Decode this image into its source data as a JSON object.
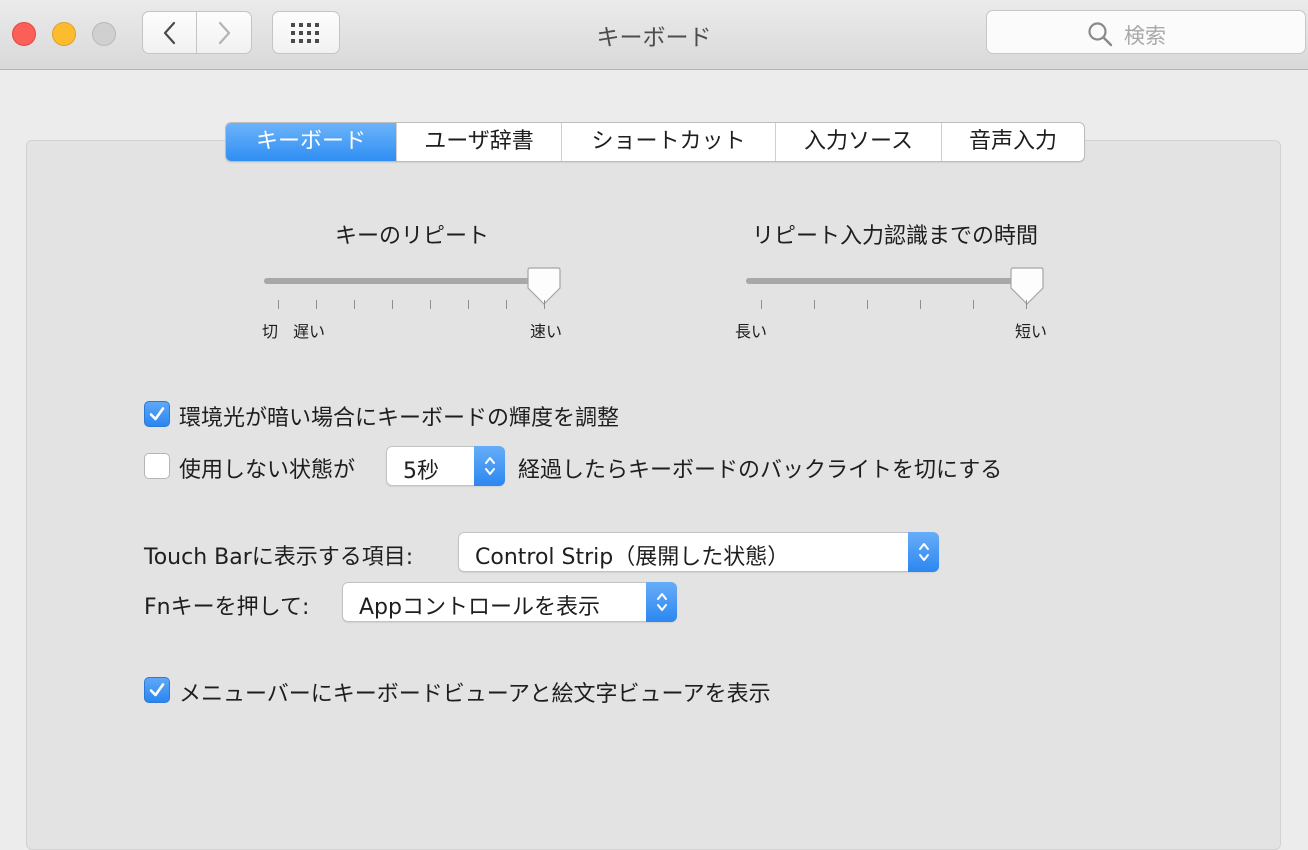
{
  "window": {
    "title": "キーボード",
    "search_placeholder": "検索"
  },
  "tabs": [
    {
      "label": "キーボード",
      "active": true
    },
    {
      "label": "ユーザ辞書",
      "active": false
    },
    {
      "label": "ショートカット",
      "active": false
    },
    {
      "label": "入力ソース",
      "active": false
    },
    {
      "label": "音声入力",
      "active": false
    }
  ],
  "key_repeat": {
    "title": "キーのリピート",
    "label_off": "切",
    "label_slow": "遅い",
    "label_fast": "速い",
    "level": 1.0
  },
  "delay_until_repeat": {
    "title": "リピート入力認識までの時間",
    "label_long": "長い",
    "label_short": "短い",
    "level": 1.0
  },
  "options": {
    "adjust_brightness": {
      "label": "環境光が暗い場合にキーボードの輝度を調整",
      "checked": true
    },
    "backlight_off": {
      "label_before": "使用しない状態が",
      "value": "5秒",
      "label_after": "経過したらキーボードのバックライトを切にする",
      "checked": false
    },
    "touch_bar": {
      "label": "Touch Barに表示する項目:",
      "value": "Control Strip（展開した状態）"
    },
    "fn_key": {
      "label": "Fnキーを押して:",
      "value": "Appコントロールを表示"
    },
    "show_viewers": {
      "label": "メニューバーにキーボードビューアと絵文字ビューアを表示",
      "checked": true
    }
  },
  "colors": {
    "accent": "#2f8ef3",
    "close": "#fc5f57",
    "minimize": "#fdbc2e",
    "zoom_disabled": "#d0d0d0"
  }
}
